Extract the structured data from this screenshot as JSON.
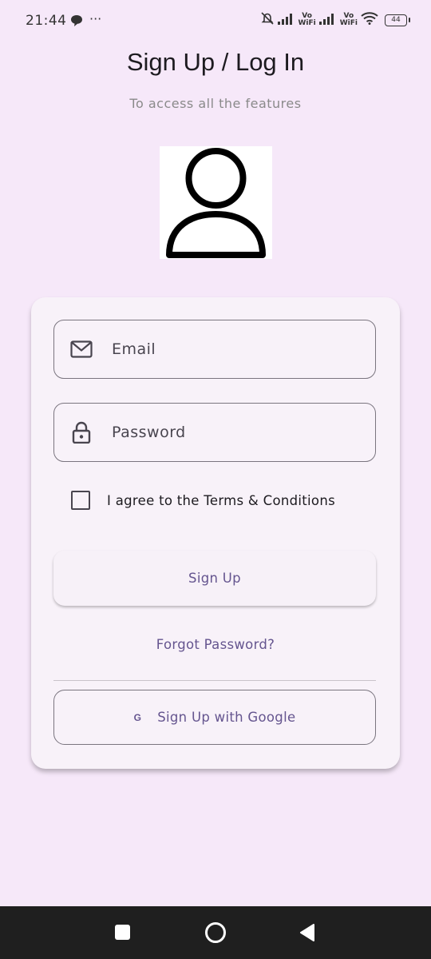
{
  "status_bar": {
    "time": "21:44",
    "dots": "···",
    "vowifi_top": "Vo",
    "vowifi_bottom": "WiFi",
    "battery": "44",
    "icons": [
      "chat-bubble-icon",
      "muted-bell-icon",
      "signal-icon",
      "wifi-icon",
      "battery-icon"
    ]
  },
  "header": {
    "title": "Sign Up / Log In",
    "subtitle": "To access all the features"
  },
  "avatar": {
    "icon": "user-icon"
  },
  "form": {
    "email_placeholder": "Email",
    "email_icon": "mail-icon",
    "password_placeholder": "Password",
    "password_icon": "lock-icon",
    "agree_label": "I agree to the Terms & Conditions",
    "agree_checked": false,
    "signup_label": "Sign Up",
    "forgot_label": "Forgot Password?",
    "google_icon_text": "G",
    "google_label": "Sign Up with Google"
  },
  "colors": {
    "background": "#f6e8f9",
    "card": "#f8f2f9",
    "accent": "#65558f",
    "nav_bar": "#1f1f1f"
  },
  "nav_bar": {
    "icons": [
      "recents-icon",
      "home-icon",
      "back-icon"
    ]
  }
}
